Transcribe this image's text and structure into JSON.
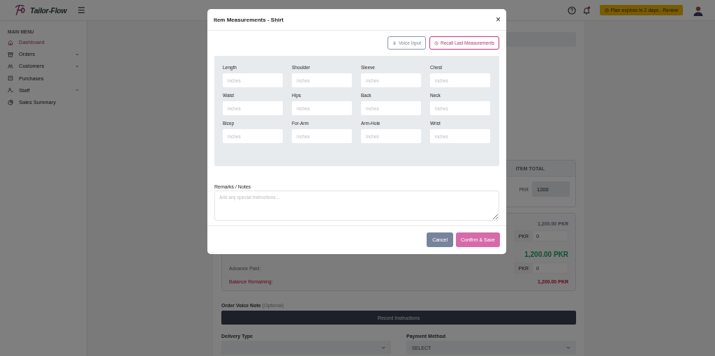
{
  "app": {
    "name": "Tailor-Flow"
  },
  "header": {
    "plan_banner": "Plan expires in 2 days - Renew",
    "notification_unread": true
  },
  "sidebar": {
    "section": "MAIN MENU",
    "items": [
      {
        "label": "Dashboard",
        "selected": true,
        "expandable": false
      },
      {
        "label": "Orders",
        "selected": false,
        "expandable": true
      },
      {
        "label": "Customers",
        "selected": false,
        "expandable": true
      },
      {
        "label": "Purchases",
        "selected": false,
        "expandable": false
      },
      {
        "label": "Staff",
        "selected": false,
        "expandable": true
      },
      {
        "label": "Sales Summary",
        "selected": false,
        "expandable": false
      }
    ]
  },
  "order": {
    "item_table": {
      "column": "ITEM TOTAL",
      "currency": "PKR",
      "value": "1200"
    },
    "summary": {
      "subtotal": "1,200.00 PKR",
      "discount_currency": "PKR",
      "discount": "0",
      "grand_total": "1,200.00 PKR",
      "advance_label": "Advance Paid:",
      "advance_currency": "PKR",
      "advance": "0",
      "balance_label": "Balance Remaining:",
      "balance": "1,200.00 PKR"
    },
    "voice_note": {
      "label": "Order Voice Note",
      "hint": "(Optional)",
      "button": "Record Instructions"
    },
    "delivery_type": {
      "label": "Delivery Type"
    },
    "payment_method": {
      "label": "Payment Method",
      "value": "SELECT"
    }
  },
  "modal": {
    "title": "Item Measurements - Shirt",
    "close": "×",
    "voice_button": "Voice Input",
    "recall_button": "Recall Last Measurements",
    "fields": [
      {
        "label": "Length",
        "placeholder": "inches"
      },
      {
        "label": "Shoulder",
        "placeholder": "inches"
      },
      {
        "label": "Sleeve",
        "placeholder": "inches"
      },
      {
        "label": "Chest",
        "placeholder": "inches"
      },
      {
        "label": "Waist",
        "placeholder": "inches"
      },
      {
        "label": "Hips",
        "placeholder": "inches"
      },
      {
        "label": "Back",
        "placeholder": "inches"
      },
      {
        "label": "Neck",
        "placeholder": "inches"
      },
      {
        "label": "Bicep",
        "placeholder": "inches"
      },
      {
        "label": "For-Arm",
        "placeholder": "inches"
      },
      {
        "label": "Arm-Hole",
        "placeholder": "inches"
      },
      {
        "label": "Wrist",
        "placeholder": "inches"
      }
    ],
    "remarks": {
      "label": "Remarks / Notes",
      "placeholder": "Add any special instructions..."
    },
    "cancel": "Cancel",
    "confirm": "Confirm & Save"
  }
}
